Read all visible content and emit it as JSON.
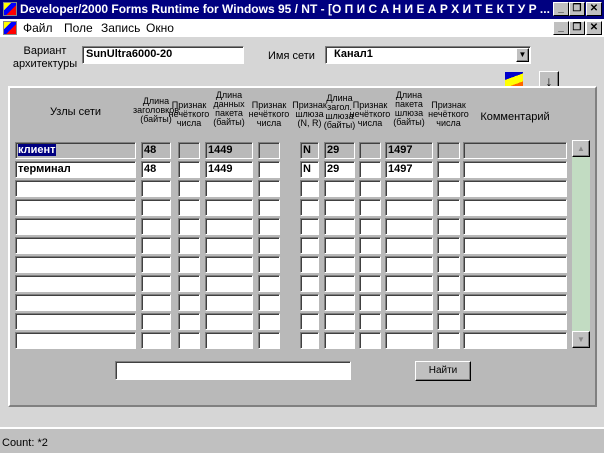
{
  "window": {
    "title": "Developer/2000 Forms Runtime for Windows 95 / NT - [О П И С А Н И Е   А Р Х И Т Е К Т У Р ..."
  },
  "menu": [
    "Файл",
    "Поле",
    "Запись",
    "Окно"
  ],
  "form": {
    "variant_label": "Вариант\nархитектуры",
    "variant_value": "SunUltra6000-20",
    "network_label": "Имя сети",
    "network_value": "Канал1"
  },
  "icons": {
    "report": "report-icon",
    "down": "↓"
  },
  "columns": [
    "Узлы сети",
    "Длина\nзаголовков\n(байты)",
    "Признак\nнечёткого\nчисла",
    "Длина\nданных\nпакета\n(байты)",
    "Признак\nнечёткого\nчисла",
    "Признак\nшлюза\n(N, R)",
    "Длина\nзагол.\nшлюза\n(байты)",
    "Признак\nнечёткого\nчисла",
    "Длина\nпакета\nшлюза\n(байты)",
    "Признак\nнечёткого\nчисла",
    "Комментарий"
  ],
  "rows": [
    [
      "клиент",
      "48",
      "",
      "1449",
      "",
      "N",
      "29",
      "",
      "1497",
      "",
      ""
    ],
    [
      "терминал",
      "48",
      "",
      "1449",
      "",
      "N",
      "29",
      "",
      "1497",
      "",
      ""
    ],
    [
      "",
      "",
      "",
      "",
      "",
      "",
      "",
      "",
      "",
      "",
      ""
    ],
    [
      "",
      "",
      "",
      "",
      "",
      "",
      "",
      "",
      "",
      "",
      ""
    ],
    [
      "",
      "",
      "",
      "",
      "",
      "",
      "",
      "",
      "",
      "",
      ""
    ],
    [
      "",
      "",
      "",
      "",
      "",
      "",
      "",
      "",
      "",
      "",
      ""
    ],
    [
      "",
      "",
      "",
      "",
      "",
      "",
      "",
      "",
      "",
      "",
      ""
    ],
    [
      "",
      "",
      "",
      "",
      "",
      "",
      "",
      "",
      "",
      "",
      ""
    ],
    [
      "",
      "",
      "",
      "",
      "",
      "",
      "",
      "",
      "",
      "",
      ""
    ],
    [
      "",
      "",
      "",
      "",
      "",
      "",
      "",
      "",
      "",
      "",
      ""
    ],
    [
      "",
      "",
      "",
      "",
      "",
      "",
      "",
      "",
      "",
      "",
      ""
    ]
  ],
  "search": {
    "value": "",
    "button": "Найти"
  },
  "status": {
    "text": "Count: *2"
  }
}
